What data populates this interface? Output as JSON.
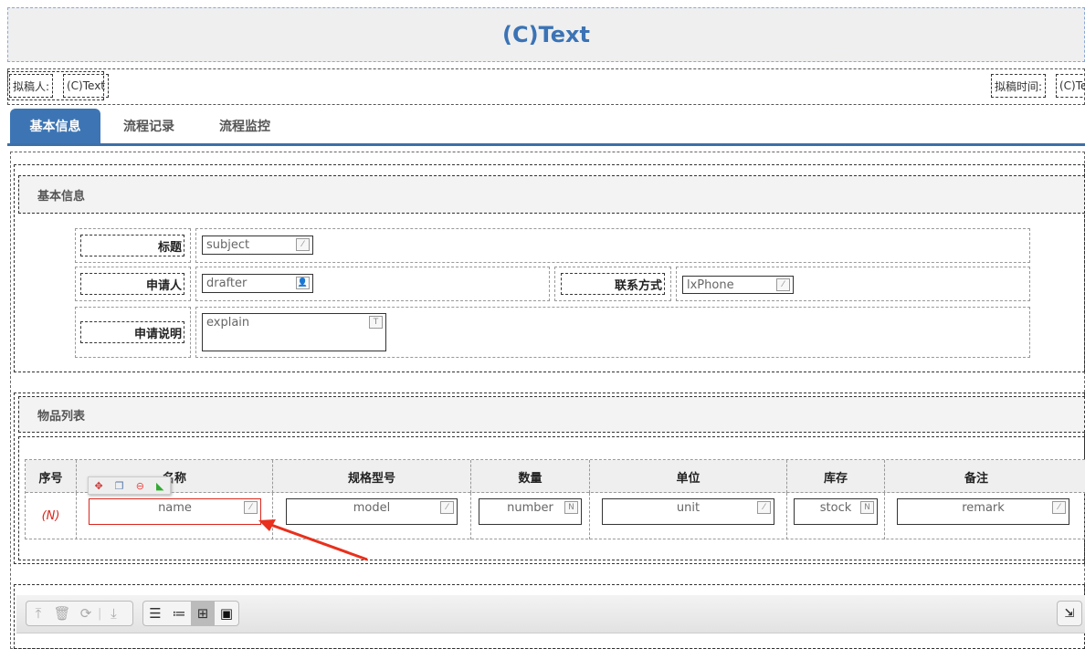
{
  "header": {
    "title": "(C)Text"
  },
  "meta": {
    "drafter_label": "拟稿人:",
    "drafter_value": "(C)Text",
    "time_label": "拟稿时间:",
    "time_value": "(C)Tex"
  },
  "tabs": [
    {
      "label": "基本信息",
      "active": true
    },
    {
      "label": "流程记录"
    },
    {
      "label": "流程监控"
    }
  ],
  "basic": {
    "section_title": "基本信息",
    "subject_label": "标题",
    "subject_value": "subject",
    "applicant_label": "申请人",
    "applicant_value": "drafter",
    "contact_label": "联系方式",
    "contact_value": "lxPhone",
    "explain_label": "申请说明",
    "explain_value": "explain"
  },
  "items": {
    "section_title": "物品列表",
    "columns": [
      "序号",
      "名称",
      "规格型号",
      "数量",
      "单位",
      "库存",
      "备注"
    ],
    "row": {
      "index": "(N)",
      "cells": [
        "name",
        "model",
        "number",
        "unit",
        "stock",
        "remark"
      ]
    }
  },
  "colors": {
    "accent": "#3d75b4",
    "selected": "#d9261c"
  }
}
